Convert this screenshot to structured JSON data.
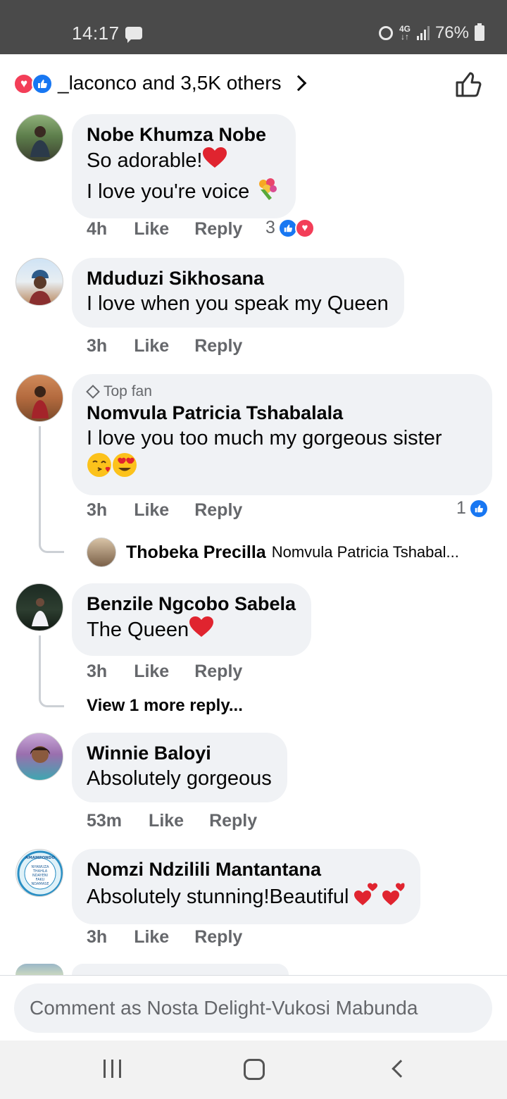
{
  "status_bar": {
    "time": "14:17",
    "network_top": "4G",
    "network_bottom": "↓↑",
    "battery": "76%"
  },
  "reactions_summary": {
    "text": "_laconco and 3,5K others",
    "icons": [
      "heart-reaction-icon",
      "like-reaction-icon"
    ]
  },
  "comments": [
    {
      "author": "Nobe Khumza Nobe",
      "lines": [
        "So adorable!",
        "I love you're voice"
      ],
      "emojis": [
        "red-heart",
        "bouquet"
      ],
      "time": "4h",
      "like_label": "Like",
      "reply_label": "Reply",
      "reaction_count": "3"
    },
    {
      "author": "Mduduzi Sikhosana",
      "lines": [
        "I love when you speak  my Queen"
      ],
      "time": "3h",
      "like_label": "Like",
      "reply_label": "Reply"
    },
    {
      "badge": "Top fan",
      "author": "Nomvula Patricia Tshabalala",
      "lines": [
        "I love you too much my gorgeous sister"
      ],
      "emojis": [
        "kissing-face",
        "heart-eyes-face"
      ],
      "time": "3h",
      "like_label": "Like",
      "reply_label": "Reply",
      "reaction_count": "1",
      "reply_preview": {
        "author": "Thobeka Precilla",
        "snippet": "Nomvula Patricia Tshabal..."
      }
    },
    {
      "author": "Benzile Ngcobo Sabela",
      "lines": [
        "The Queen"
      ],
      "emojis": [
        "red-heart"
      ],
      "time": "3h",
      "like_label": "Like",
      "reply_label": "Reply",
      "view_more": "View 1 more reply..."
    },
    {
      "author": "Winnie Baloyi",
      "lines": [
        "Absolutely gorgeous"
      ],
      "time": "53m",
      "like_label": "Like",
      "reply_label": "Reply"
    },
    {
      "author": "Nomzi Ndzilili Mantantana",
      "lines": [
        "Absolutely stunning!Beautiful"
      ],
      "emojis": [
        "two-hearts"
      ],
      "time": "3h",
      "like_label": "Like",
      "reply_label": "Reply",
      "avatar_logo_text": [
        "AMAMPONDO",
        "NYAWUZA",
        "THAHLA",
        "NDAYENI",
        "FAKU",
        "NDAMASE"
      ]
    }
  ],
  "composer": {
    "placeholder": "Comment as Nosta Delight-Vukosi Mabunda"
  },
  "colors": {
    "facebook_blue": "#1877f2",
    "love_red": "#f33e58",
    "bubble_gray": "#f0f2f5",
    "meta_gray": "#65676b"
  }
}
